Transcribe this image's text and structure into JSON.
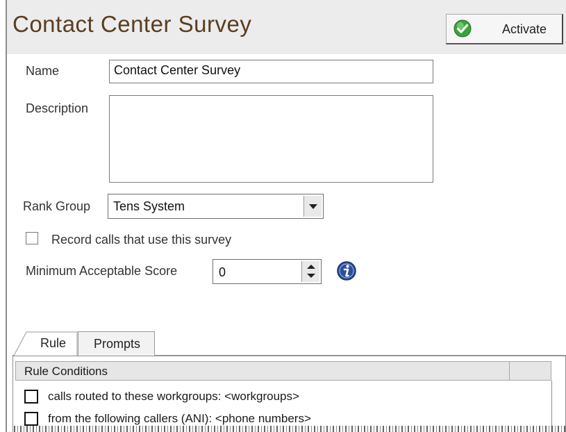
{
  "header": {
    "title": "Contact Center Survey",
    "activate_label": "Activate",
    "activate_icon": "green-check-icon"
  },
  "form": {
    "name_label": "Name",
    "name_value": "Contact Center Survey",
    "description_label": "Description",
    "description_value": "",
    "rank_group_label": "Rank Group",
    "rank_group_value": "Tens System",
    "record_calls_label": "Record calls that use this survey",
    "record_calls_checked": false,
    "min_score_label": "Minimum Acceptable Score",
    "min_score_value": "0"
  },
  "tabs": [
    {
      "label": "Rule",
      "active": true
    },
    {
      "label": "Prompts",
      "active": false
    }
  ],
  "rule_conditions": {
    "header": "Rule Conditions",
    "items": [
      {
        "label": "calls routed to these workgroups: <workgroups>",
        "checked": false
      },
      {
        "label": "from the following callers (ANI): <phone numbers>",
        "checked": false
      }
    ]
  },
  "colors": {
    "title": "#5a3d20",
    "header_bg": "#ececec",
    "check_green": "#3aa33a"
  }
}
